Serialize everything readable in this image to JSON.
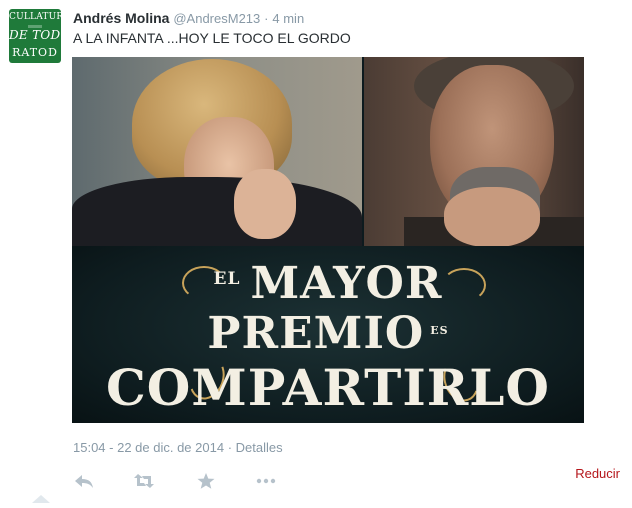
{
  "tweet": {
    "author_name": "Andrés Molina",
    "handle": "@AndresM213",
    "separator": "·",
    "age": "4 min",
    "text": "A LA INFANTA ...HOY LE TOCO EL GORDO"
  },
  "avatar": {
    "line1": "CULLATURA",
    "line2": "DE TODO",
    "line3": "RATOD"
  },
  "poster": {
    "line1_prefix": "EL",
    "line1_main": "MAYOR",
    "line2_main": "PREMIO",
    "line2_suffix": "ES",
    "line3_main": "COMPARTIRLO"
  },
  "meta": {
    "timestamp": "15:04 - 22 de dic. de 2014",
    "separator": "·",
    "details_label": "Detalles"
  },
  "actions": {
    "collapse_label": "Reducir",
    "icons": [
      "reply-icon",
      "retweet-icon",
      "favorite-icon",
      "more-icon"
    ]
  },
  "colors": {
    "name_text": "#292f33",
    "muted_text": "#8899a6",
    "collapse_link": "#b5161b",
    "action_icons": "#b6c2cb",
    "avatar_bg": "#1f7a3a"
  }
}
